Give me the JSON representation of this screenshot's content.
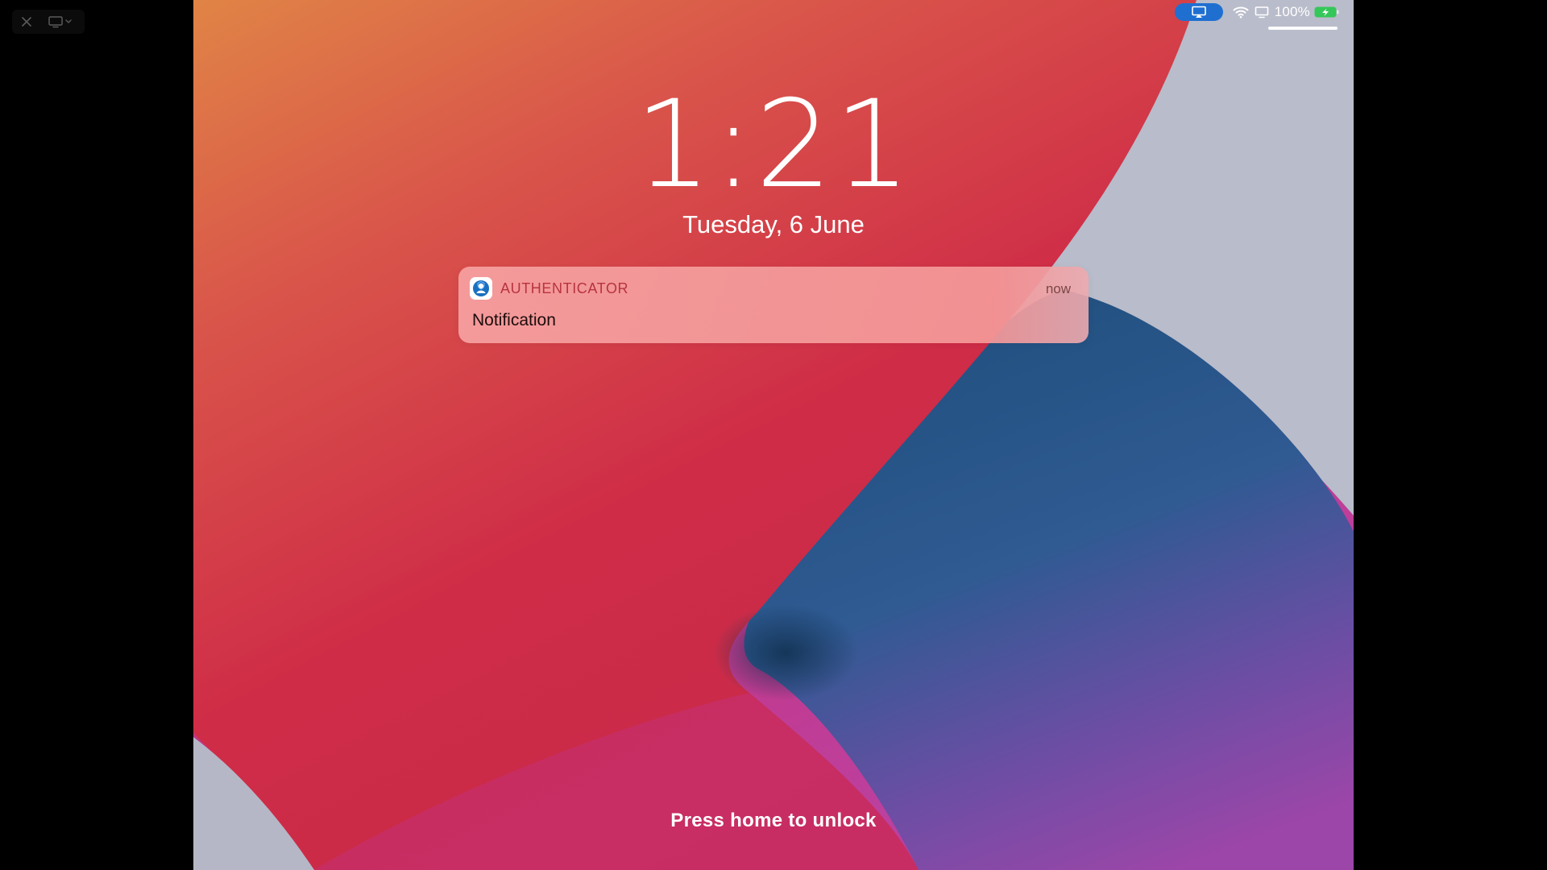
{
  "window_controls": {
    "close_icon": "close-icon",
    "screen_icon": "display-menu-icon"
  },
  "status_bar": {
    "airplay_icon": "screen-mirroring-icon",
    "airplay_color": "#1f6fd1",
    "wifi_icon": "wifi-icon",
    "display_icon": "external-display-icon",
    "battery_percent": "100%",
    "battery_icon": "battery-charging-icon",
    "battery_color": "#35c759"
  },
  "lock_screen": {
    "time": "1:21",
    "date": "Tuesday, 6 June",
    "unlock_hint": "Press home to unlock"
  },
  "notification": {
    "app_icon": "authenticator-app-icon",
    "app_name": "AUTHENTICATOR",
    "time": "now",
    "body": "Notification"
  },
  "colors": {
    "wallpaper_red": "#cf2a48",
    "wallpaper_orange": "#e08446",
    "wallpaper_blue": "#1f4f7d",
    "wallpaper_purple": "#a53fa6",
    "wallpaper_grey": "#b9bcca",
    "notification_app_name": "#b7343f"
  }
}
